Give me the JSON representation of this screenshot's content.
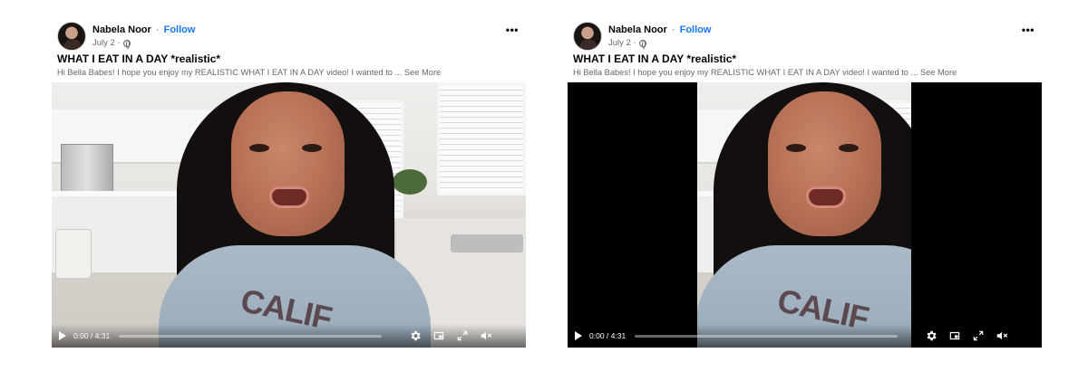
{
  "posts": [
    {
      "author": "Nabela Noor",
      "separator": "·",
      "follow": "Follow",
      "date": "July 2 ·",
      "title": "WHAT I EAT IN A DAY *realistic*",
      "description": "Hi Bella Babes! I hope you enjoy my REALISTIC WHAT I EAT IN A DAY video! I wanted to ...",
      "see_more": "See More",
      "sweater_print": "CALIF",
      "video": {
        "time": "0:00 / 4:31",
        "progress": 0.0,
        "aspect": "fill"
      }
    },
    {
      "author": "Nabela Noor",
      "separator": "·",
      "follow": "Follow",
      "date": "July 2 ·",
      "title": "WHAT I EAT IN A DAY *realistic*",
      "description": "Hi Bella Babes! I hope you enjoy my REALISTIC WHAT I EAT IN A DAY video! I wanted to ...",
      "see_more": "See More",
      "sweater_print": "CALIF",
      "video": {
        "time": "0:00 / 4:31",
        "progress": 0.0,
        "aspect": "letterboxed"
      }
    }
  ],
  "icons": [
    "more-icon",
    "globe-icon",
    "play-icon",
    "gear-icon",
    "pip-icon",
    "fullscreen-icon",
    "volume-muted-icon"
  ],
  "colors": {
    "follow": "#1877f2",
    "secondary_text": "#65676b"
  }
}
